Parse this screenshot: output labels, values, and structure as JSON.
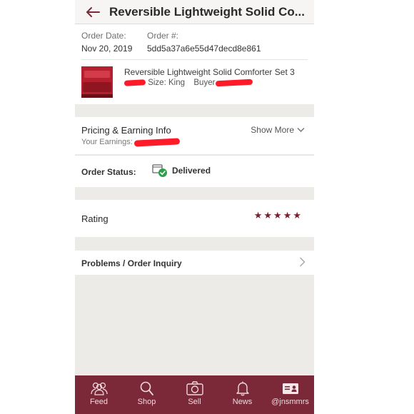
{
  "header": {
    "title": "Reversible Lightweight Solid Co..."
  },
  "order": {
    "date_label": "Order Date:",
    "date_value": "Nov 20, 2019",
    "number_label": "Order #:",
    "number_value": "5dd5a37a6e55d47decd8e861",
    "item_title": "Reversible Lightweight Solid Comforter Set 3",
    "item_size": "Size: King",
    "item_buyer_label": "Buyer"
  },
  "pricing": {
    "title": "Pricing & Earning Info",
    "earnings_label": "Your Earnings:",
    "show_more": "Show More"
  },
  "status": {
    "label": "Order Status:",
    "value": "Delivered"
  },
  "rating": {
    "label": "Rating",
    "stars": 5
  },
  "problems": {
    "label": "Problems / Order Inquiry"
  },
  "tabs": [
    {
      "label": "Feed",
      "icon": "people-icon"
    },
    {
      "label": "Shop",
      "icon": "search-icon"
    },
    {
      "label": "Sell",
      "icon": "camera-icon"
    },
    {
      "label": "News",
      "icon": "bell-icon"
    },
    {
      "label": "@jnsmmrs",
      "icon": "profile-card-icon"
    }
  ],
  "colors": {
    "brand": "#7b2939",
    "star": "#7a1d2d",
    "delivered_check": "#2e9e4a",
    "redaction": "#ff1a2a"
  }
}
